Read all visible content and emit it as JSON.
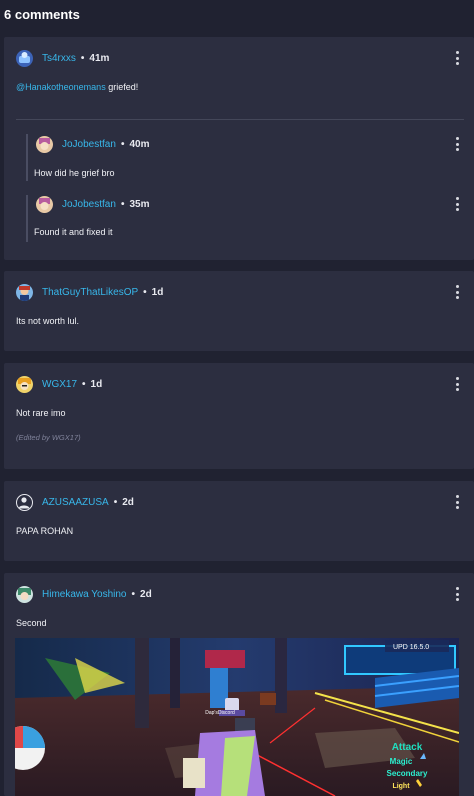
{
  "header": {
    "title": "6 comments"
  },
  "comments": [
    {
      "username": "Ts4rxxs",
      "time": "41m",
      "mention": "@Hanakotheonemans",
      "text": " griefed!",
      "replies": [
        {
          "username": "JoJobestfan",
          "time": "40m",
          "text": "How did he grief bro"
        },
        {
          "username": "JoJobestfan",
          "time": "35m",
          "text": "Found it and fixed it"
        }
      ]
    },
    {
      "username": "ThatGuyThatLikesOP",
      "time": "1d",
      "text": "Its not worth lul."
    },
    {
      "username": "WGX17",
      "time": "1d",
      "text": "Not rare imo",
      "edited": "(Edited by WGX17)"
    },
    {
      "username": "AZUSAAZUSA",
      "time": "2d",
      "text": "PAPA ROHAN"
    },
    {
      "username": "Himekawa Yoshino",
      "time": "2d",
      "text": "Second",
      "attachment": {
        "hud_top": "UPD 16.5.0",
        "player_tag": "Dap'sDiscord",
        "skills": [
          "Attack",
          "Magic",
          "Secondary",
          "Light"
        ]
      }
    }
  ],
  "separator": "•",
  "colors": {
    "background": "#202231",
    "card": "#2c2e40",
    "username": "#38b7ea"
  }
}
